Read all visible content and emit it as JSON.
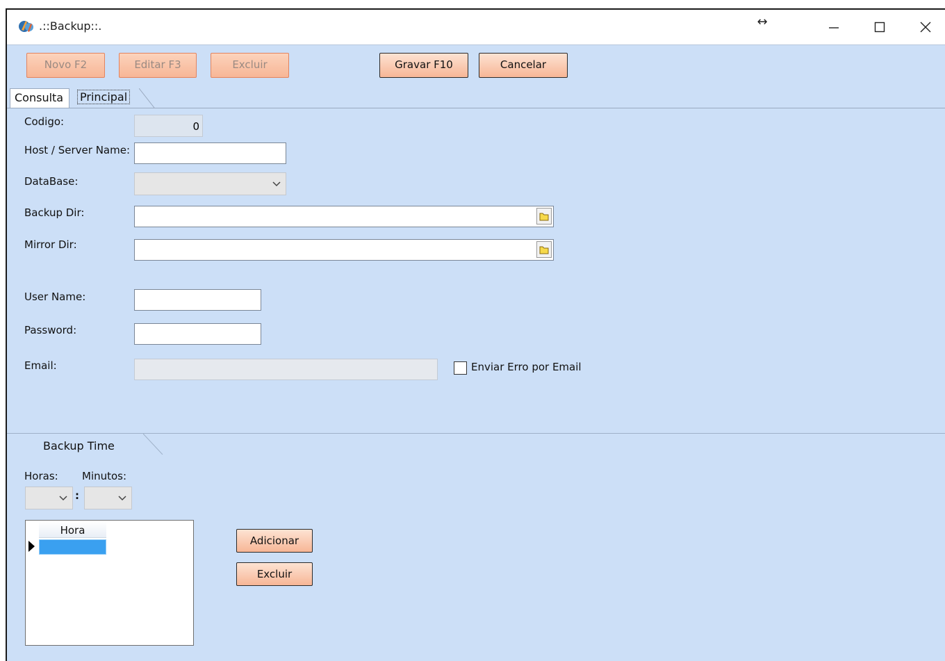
{
  "window": {
    "title": ".::Backup::."
  },
  "toolbar": {
    "novo": "Novo F2",
    "editar": "Editar F3",
    "excluir": "Excluir",
    "gravar": "Gravar F10",
    "cancelar": "Cancelar"
  },
  "tabs": [
    {
      "label": "Consulta"
    },
    {
      "label": "Principal"
    }
  ],
  "form": {
    "codigo_label": "Codigo:",
    "codigo_value": "0",
    "host_label": "Host / Server Name:",
    "host_value": "",
    "database_label": "DataBase:",
    "database_value": "",
    "backup_dir_label": "Backup Dir:",
    "backup_dir_value": "",
    "mirror_dir_label": "Mirror Dir:",
    "mirror_dir_value": "",
    "username_label": "User Name:",
    "username_value": "",
    "password_label": "Password:",
    "password_value": "",
    "email_label": "Email:",
    "email_value": "",
    "enviar_erro_label": "Enviar Erro por Email",
    "enviar_erro_checked": false
  },
  "backup_time": {
    "tab_label": "Backup Time",
    "horas_label": "Horas:",
    "minutos_label": "Minutos:",
    "separator": ":",
    "grid_header": "Hora",
    "adicionar": "Adicionar",
    "excluir": "Excluir"
  },
  "icons": {
    "app": "app-logo-icon",
    "resize": "resize-horizontal-icon",
    "minimize": "minimize-icon",
    "maximize": "maximize-icon",
    "close": "close-icon",
    "folder": "folder-icon"
  }
}
